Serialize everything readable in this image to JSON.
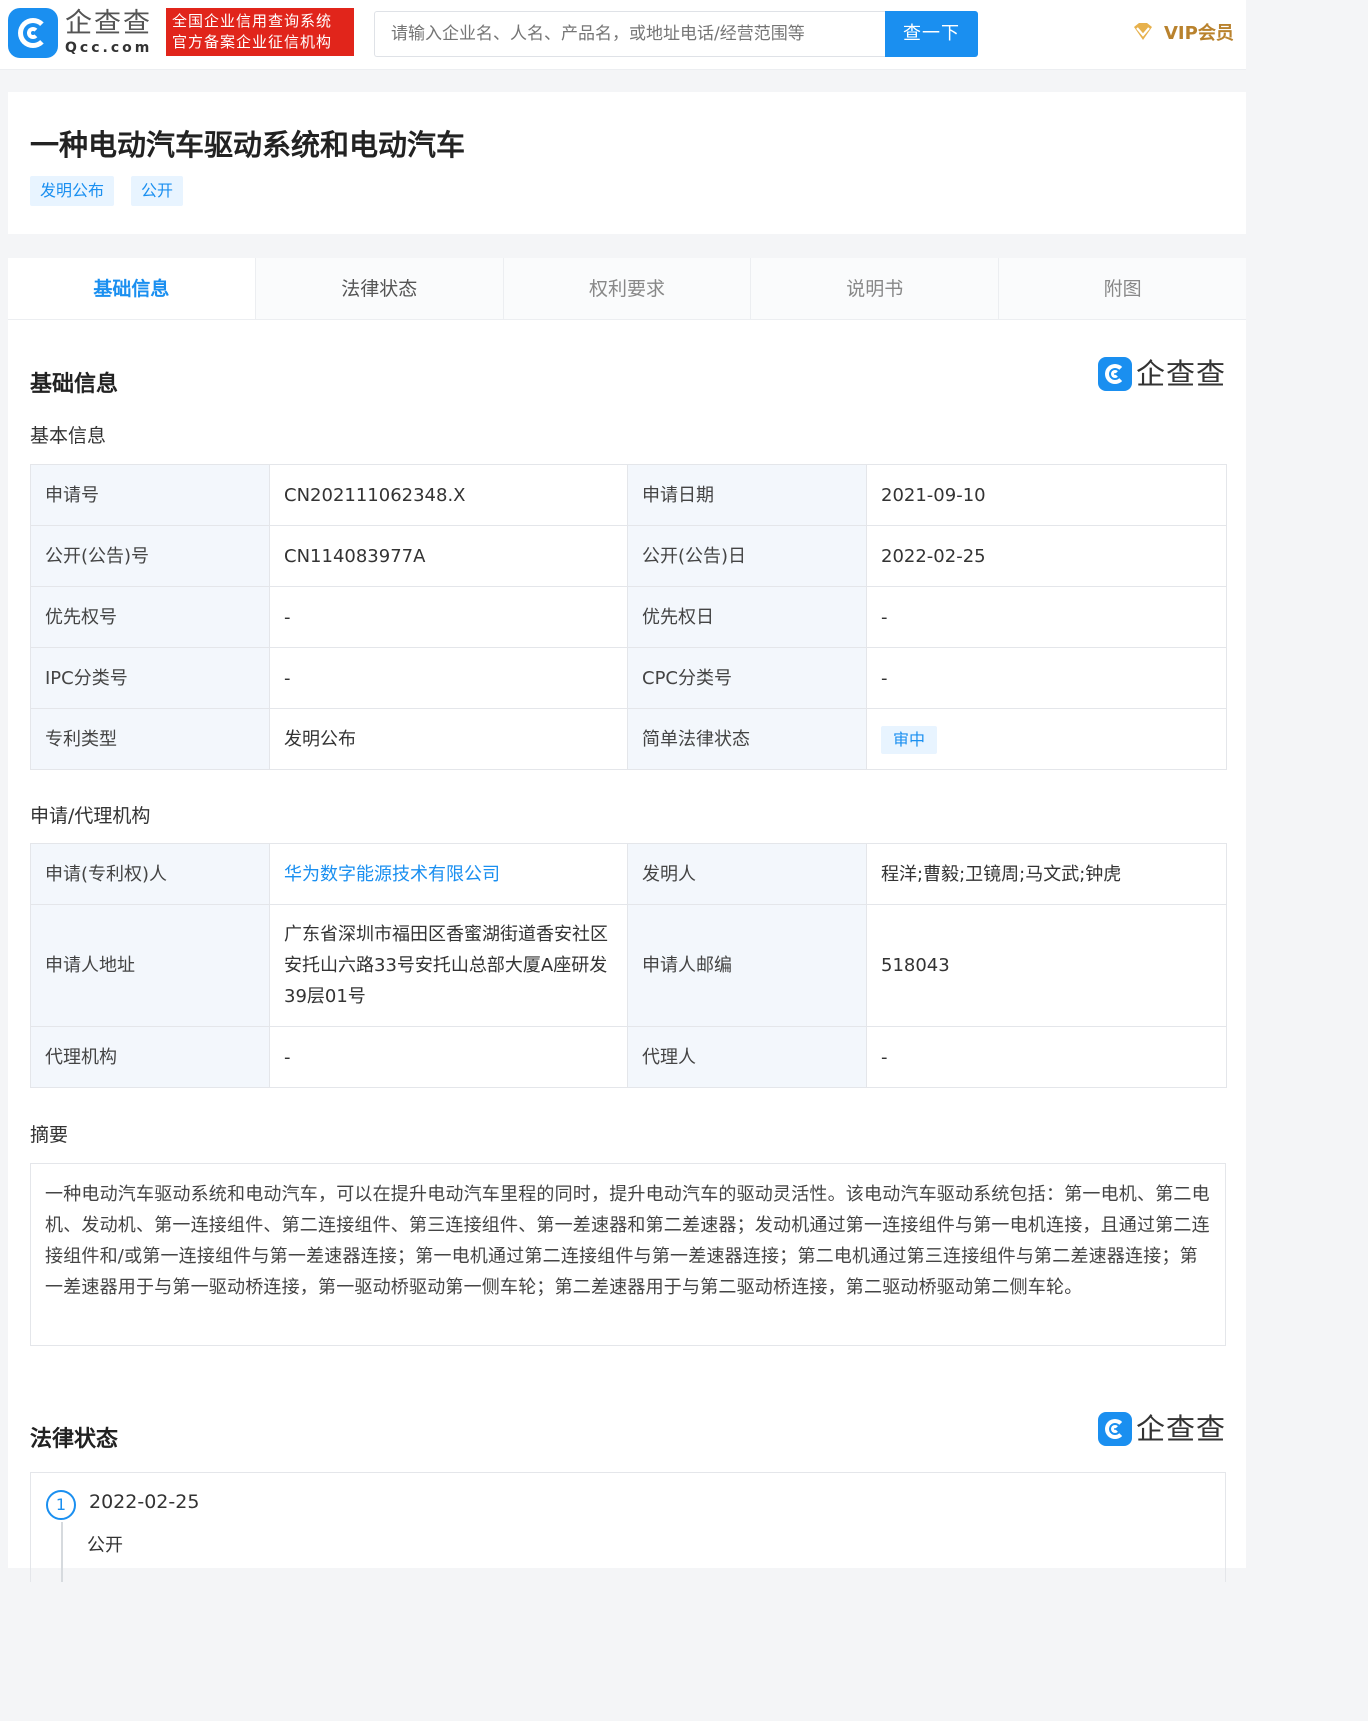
{
  "header": {
    "logo_cn": "企查查",
    "logo_en": "Qcc.com",
    "slogan_line1": "全国企业信用查询系统",
    "slogan_line2": "官方备案企业征信机构",
    "search_placeholder": "请输入企业名、人名、产品名，或地址电话/经营范围等",
    "search_button": "查一下",
    "vip_label": "VIP会员"
  },
  "patent": {
    "title": "一种电动汽车驱动系统和电动汽车",
    "tags": [
      "发明公布",
      "公开"
    ]
  },
  "tabs": [
    "基础信息",
    "法律状态",
    "权利要求",
    "说明书",
    "附图"
  ],
  "brand_watermark": "企查查",
  "basic": {
    "section_title": "基础信息",
    "subsection_title": "基本信息",
    "rows": [
      {
        "k1": "申请号",
        "v1": "CN202111062348.X",
        "k2": "申请日期",
        "v2": "2021-09-10"
      },
      {
        "k1": "公开(公告)号",
        "v1": "CN114083977A",
        "k2": "公开(公告)日",
        "v2": "2022-02-25"
      },
      {
        "k1": "优先权号",
        "v1": "-",
        "k2": "优先权日",
        "v2": "-"
      },
      {
        "k1": "IPC分类号",
        "v1": "-",
        "k2": "CPC分类号",
        "v2": "-"
      },
      {
        "k1": "专利类型",
        "v1": "发明公布",
        "k2": "简单法律状态",
        "v2": "审中"
      }
    ]
  },
  "agency": {
    "subsection_title": "申请/代理机构",
    "rows": [
      {
        "k1": "申请(专利权)人",
        "v1": "华为数字能源技术有限公司",
        "k2": "发明人",
        "v2": "程洋;曹毅;卫镜周;马文武;钟虎"
      },
      {
        "k1": "申请人地址",
        "v1": "广东省深圳市福田区香蜜湖街道香安社区安托山六路33号安托山总部大厦A座研发39层01号",
        "k2": "申请人邮编",
        "v2": "518043"
      },
      {
        "k1": "代理机构",
        "v1": "-",
        "k2": "代理人",
        "v2": "-"
      }
    ]
  },
  "abstract": {
    "title": "摘要",
    "text": "一种电动汽车驱动系统和电动汽车，可以在提升电动汽车里程的同时，提升电动汽车的驱动灵活性。该电动汽车驱动系统包括：第一电机、第二电机、发动机、第一连接组件、第二连接组件、第三连接组件、第一差速器和第二差速器；发动机通过第一连接组件与第一电机连接，且通过第二连接组件和/或第一连接组件与第一差速器连接；第一电机通过第二连接组件与第一差速器连接；第二电机通过第三连接组件与第二差速器连接；第一差速器用于与第一驱动桥连接，第一驱动桥驱动第一侧车轮；第二差速器用于与第二驱动桥连接，第二驱动桥驱动第二侧车轮。"
  },
  "legal": {
    "section_title": "法律状态",
    "events": [
      {
        "index": "1",
        "date": "2022-02-25",
        "status": "公开"
      }
    ]
  },
  "colors": {
    "accent": "#1a8ff0",
    "slogan_bg": "#e1251b",
    "vip": "#b9822d"
  }
}
